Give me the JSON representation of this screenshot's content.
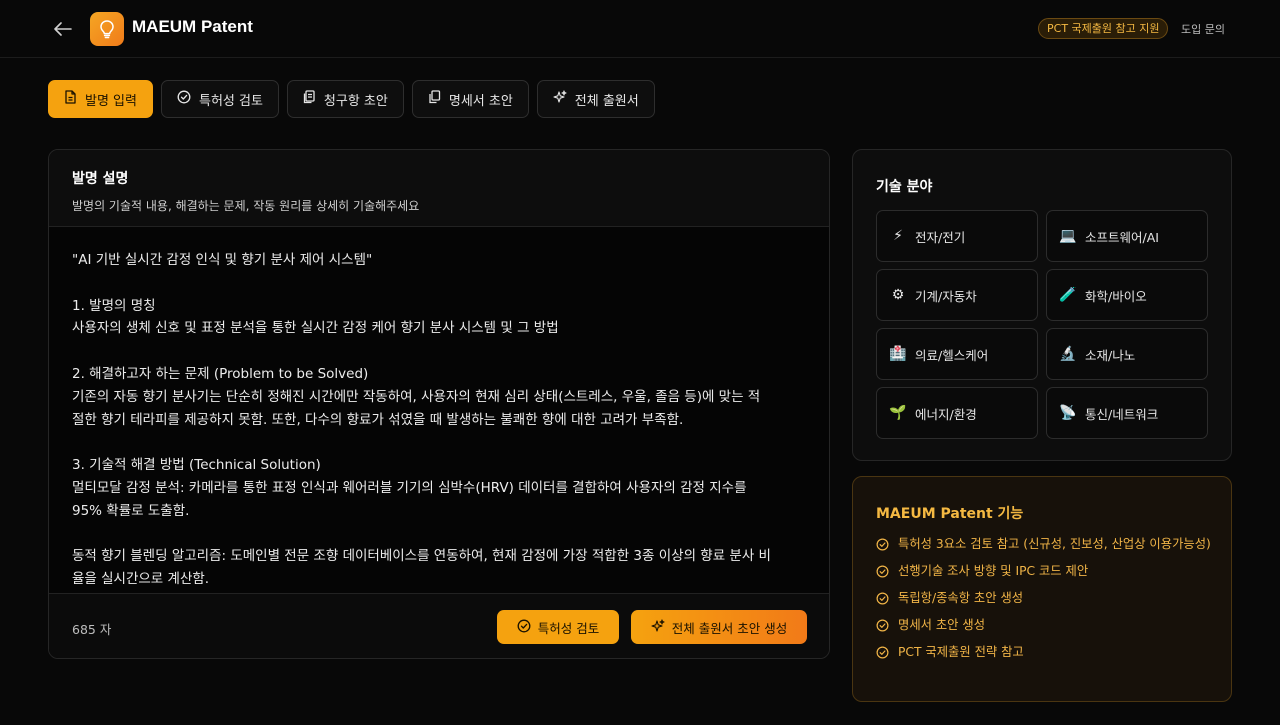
{
  "header": {
    "title": "MAEUM Patent",
    "badge": "PCT 국제출원 참고 지원",
    "inquiry": "도입 문의"
  },
  "tabs": [
    {
      "label": "발명 입력",
      "icon": "document-icon",
      "active": true
    },
    {
      "label": "특허성 검토",
      "icon": "check-circle-icon"
    },
    {
      "label": "청구항 초안",
      "icon": "clipboard-icon"
    },
    {
      "label": "명세서 초안",
      "icon": "copy-icon"
    },
    {
      "label": "전체 출원서",
      "icon": "sparkles-icon"
    }
  ],
  "invention": {
    "title": "발명 설명",
    "subtitle": "발명의 기술적 내용, 해결하는 문제, 작동 원리를 상세히 기술해주세요",
    "lines": [
      "\"AI 기반 실시간 감정 인식 및 향기 분사 제어 시스템\"",
      "",
      "1. 발명의 명칭",
      "사용자의 생체 신호 및 표정 분석을 통한 실시간 감정 케어 향기 분사 시스템 및 그 방법",
      "",
      "2. 해결하고자 하는 문제 (Problem to be Solved)",
      "기존의 자동 향기 분사기는 단순히 정해진 시간에만 작동하여, 사용자의 현재 심리 상태(스트레스, 우울, 졸음 등)에 맞는 적",
      "절한 향기 테라피를 제공하지 못함. 또한, 다수의 향료가 섞였을 때 발생하는 불쾌한 향에 대한 고려가 부족함.",
      "",
      "3. 기술적 해결 방법 (Technical Solution)",
      "멀티모달 감정 분석: 카메라를 통한 표정 인식과 웨어러블 기기의 심박수(HRV) 데이터를 결합하여 사용자의 감정 지수를",
      "95% 확률로 도출함.",
      "",
      "동적 향기 블렌딩 알고리즘: 도메인별 전문 조향 데이터베이스를 연동하여, 현재 감정에 가장 적합한 3종 이상의 향료 분사 비",
      "율을 실시간으로 계산함."
    ],
    "char_count": "685 자",
    "check_button": "특허성 검토",
    "generate_button": "전체 출원서 초안 생성"
  },
  "tech_fields": {
    "title": "기술 분야",
    "items": [
      {
        "label": "전자/전기",
        "icon": "lightning-icon",
        "glyph": "⚡"
      },
      {
        "label": "소프트웨어/AI",
        "icon": "laptop-icon",
        "glyph": "💻"
      },
      {
        "label": "기계/자동차",
        "icon": "gear-icon",
        "glyph": "⚙"
      },
      {
        "label": "화학/바이오",
        "icon": "test-tube-icon",
        "glyph": "🧪"
      },
      {
        "label": "의료/헬스케어",
        "icon": "hospital-icon",
        "glyph": "🏥"
      },
      {
        "label": "소재/나노",
        "icon": "microscope-icon",
        "glyph": "🔬"
      },
      {
        "label": "에너지/환경",
        "icon": "seedling-icon",
        "glyph": "🌱"
      },
      {
        "label": "통신/네트워크",
        "icon": "satellite-icon",
        "glyph": "📡"
      }
    ]
  },
  "features": {
    "title": "MAEUM Patent 기능",
    "items": [
      "특허성 3요소 검토 참고 (신규성, 진보성, 산업상 이용가능성)",
      "선행기술 조사 방향 및 IPC 코드 제안",
      "독립항/종속항 초안 생성",
      "명세서 초안 생성",
      "PCT 국제출원 전략 참고"
    ]
  },
  "colors": {
    "accent": "#f5a20f",
    "accent_end": "#f27a18",
    "background": "#080808",
    "feature_text": "#f0b447"
  }
}
